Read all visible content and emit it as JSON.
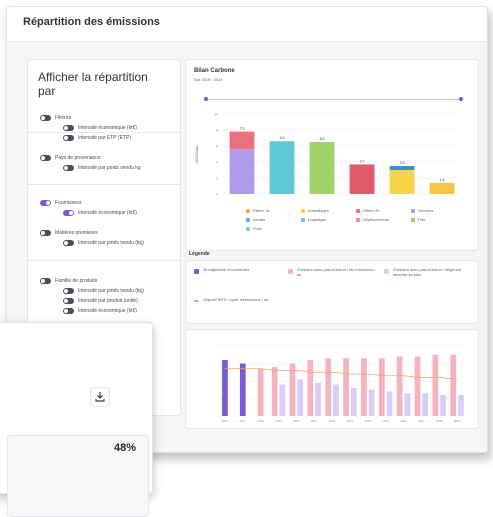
{
  "header": {
    "title": "Répartition des émissions"
  },
  "sidebar": {
    "title": "Afficher la répartition par",
    "groups": [
      {
        "label": "Filières",
        "subs": [
          "Intensité économique (kt€)",
          "Intensité par ETP (ETP)"
        ]
      },
      {
        "label": "Pays de provenance",
        "subs": [
          "Intensité par poids vendu kg"
        ]
      },
      {
        "label": "Fournisseur",
        "subs": [
          "Intensité économique (kt€)"
        ]
      },
      {
        "label": "Matières premières",
        "subs": [
          "Intensité par poids vendu (kg)"
        ]
      },
      {
        "label": "Famille de produits",
        "subs": [
          "Intensité par poids vendu (kg)",
          "Intensité par produit (unité)",
          "Intensité économique (kt€)"
        ]
      }
    ]
  },
  "top_chart": {
    "title": "Bilan Carbone",
    "subtitle": "Sur 2019 / 2024",
    "ylabel": "tCO2e/an",
    "legend": [
      "Filière 1a",
      "Emballages",
      "Filière 2b",
      "Services",
      "Achats",
      "Logistique",
      "Déplacements",
      "Fret",
      "Fuite"
    ],
    "legend_colors": [
      "#f2b233",
      "#f7d34a",
      "#e8717d",
      "#b09be8",
      "#6aa9e0",
      "#5cc8d8",
      "#f08ca0",
      "#9fc96b",
      "#7bd3c8"
    ]
  },
  "chart_data": [
    {
      "type": "bar",
      "title": "Bilan Carbone",
      "categories": [
        "A",
        "B",
        "C",
        "D",
        "E",
        "F"
      ],
      "series": [
        {
          "values": [
            7.8,
            6.6,
            6.5,
            3.7,
            3.5,
            1.4
          ]
        }
      ],
      "stack": [
        [
          5.6,
          2.2
        ],
        [
          6.6
        ],
        [
          6.5
        ],
        [
          3.7
        ],
        [
          3.0,
          0.5
        ],
        [
          1.4
        ]
      ],
      "stack_colors": [
        [
          "#b09be8",
          "#e8717d"
        ],
        [
          "#5cc8d8"
        ],
        [
          "#9fd36b"
        ],
        [
          "#e05b6a"
        ],
        [
          "#f7d34a",
          "#3a8fd8"
        ],
        [
          "#f7c44a"
        ]
      ],
      "data_labels": [
        "7.8",
        "6.6",
        "6.5",
        "3.7",
        "3.5",
        "1.4"
      ],
      "ylim": [
        0,
        10
      ],
      "yticks": [
        0,
        2,
        4,
        6,
        8,
        10
      ]
    },
    {
      "type": "bar",
      "categories": [
        "2016",
        "2017",
        "2018",
        "2019",
        "2020",
        "2021",
        "2022",
        "2023",
        "2024",
        "2025",
        "2026",
        "2027",
        "2028",
        "2029"
      ],
      "series": [
        {
          "values": [
            3.2,
            3.0,
            0,
            0,
            0,
            0,
            0,
            0,
            0,
            0,
            0,
            0,
            0,
            0
          ]
        },
        {
          "values": [
            0,
            0,
            2.7,
            2.8,
            3.0,
            3.2,
            3.3,
            3.3,
            3.3,
            3.3,
            3.4,
            3.4,
            3.5,
            3.5
          ]
        },
        {
          "values": [
            0,
            0,
            0,
            1.8,
            2.1,
            1.9,
            1.8,
            1.6,
            1.5,
            1.4,
            1.3,
            1.3,
            1.2,
            1.2
          ]
        }
      ],
      "series_colors": [
        "#7b5ad6",
        "#f4b3be",
        "#d9cdf3"
      ],
      "line": [
        2.7,
        2.7,
        2.7,
        2.6,
        2.6,
        2.5,
        2.5,
        2.4,
        2.4,
        2.3,
        2.3,
        2.2,
        2.2,
        2.1
      ],
      "ylim": [
        0,
        4
      ]
    }
  ],
  "legend_section": {
    "title": "Légende",
    "items": [
      {
        "text": "3è trajectoire d'ouvertures",
        "color": "#7b5ad6"
      },
      {
        "text": "Scénario sans plan d'action / les émissions / an",
        "color": "#f4b3be"
      },
      {
        "text": "Scénario avec plan d'action / diligence assurée au plan",
        "color": "#d9cdf3"
      },
      {
        "text": "Objectif SBTi / cycle d'émissions / an",
        "color": "#f2a25e"
      }
    ]
  },
  "overlay": {
    "percentage": "48%"
  }
}
